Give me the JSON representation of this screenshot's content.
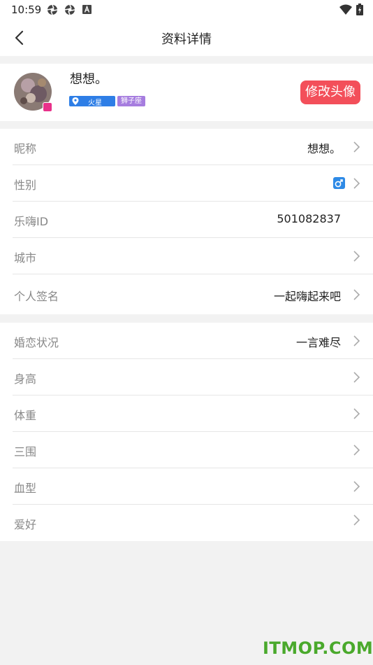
{
  "status_bar": {
    "time": "10:59",
    "left_icons": [
      "settings-like-icon",
      "settings-like-icon",
      "a-square-icon"
    ],
    "right_icons": [
      "wifi-icon",
      "battery-charging-icon"
    ]
  },
  "header": {
    "title": "资料详情",
    "back_icon": "chevron-left-icon"
  },
  "profile": {
    "nickname": "想想。",
    "location_tag": "火星",
    "zodiac_tag": "狮子座",
    "change_avatar_label": "修改头像",
    "colors": {
      "location_tag": "#2e7ee6",
      "zodiac_tag": "#a67ddf",
      "change_avatar": "#f34f5a",
      "gender_badge": "#2e8ae6"
    }
  },
  "basic_info": {
    "rows": [
      {
        "label": "昵称",
        "value": "想想。",
        "arrow": true
      },
      {
        "label": "性别",
        "value": "",
        "gender": "♂",
        "arrow": true
      },
      {
        "label": "乐嗨ID",
        "value": "501082837",
        "arrow": false
      },
      {
        "label": "城市",
        "value": "",
        "arrow": true
      },
      {
        "label": "个人签名",
        "value": "一起嗨起来吧",
        "arrow": true
      }
    ]
  },
  "extra_info": {
    "rows": [
      {
        "label": "婚恋状况",
        "value": "一言难尽",
        "arrow": true
      },
      {
        "label": "身高",
        "value": "",
        "arrow": true
      },
      {
        "label": "体重",
        "value": "",
        "arrow": true
      },
      {
        "label": "三围",
        "value": "",
        "arrow": true
      },
      {
        "label": "血型",
        "value": "",
        "arrow": true
      },
      {
        "label": "爱好",
        "value": "",
        "arrow": true
      }
    ]
  },
  "watermark": "ITMOP.COM"
}
